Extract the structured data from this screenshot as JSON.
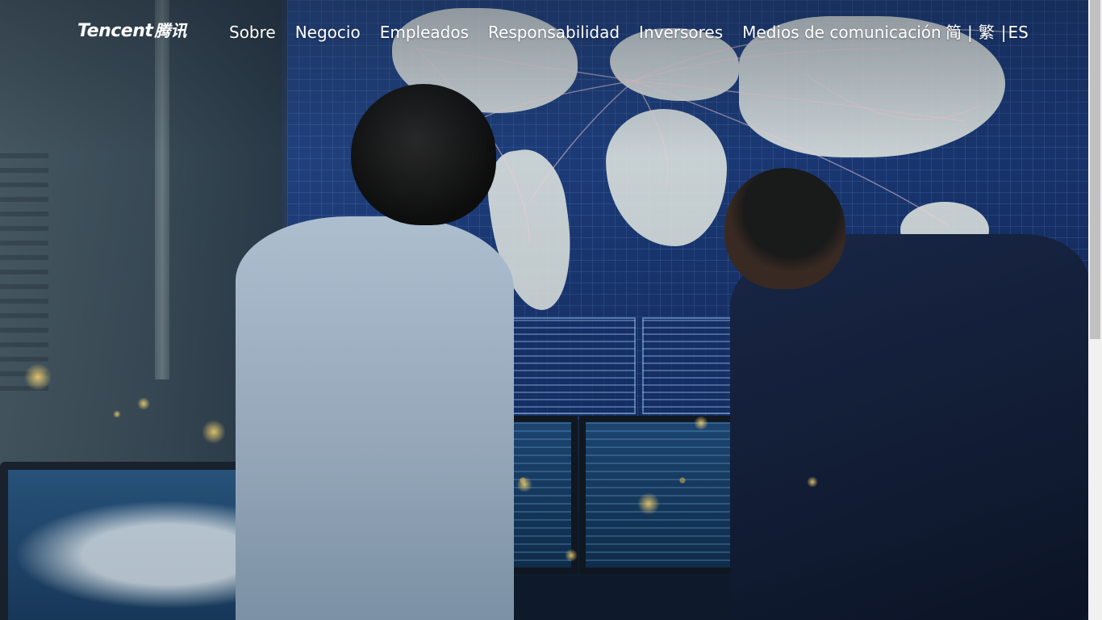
{
  "header": {
    "logo": {
      "latin": "Tencent",
      "cjk": "腾讯"
    },
    "nav": [
      {
        "label": "Sobre"
      },
      {
        "label": "Negocio"
      },
      {
        "label": "Empleados"
      },
      {
        "label": "Responsabilidad"
      },
      {
        "label": "Inversores"
      },
      {
        "label": "Medios de comunicación"
      }
    ],
    "language": {
      "simplified": "简",
      "separator": "|",
      "traditional": "繁",
      "current": "ES"
    }
  },
  "hero": {
    "image": "control-room-world-map-monitors"
  },
  "colors": {
    "nav_text": "#ffffff",
    "screen_blue": "#1b3a78"
  }
}
